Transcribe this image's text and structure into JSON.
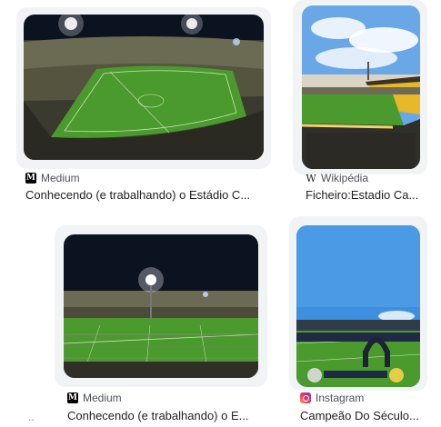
{
  "results": [
    {
      "source": "Medium",
      "favicon": "medium-icon",
      "title": "Conhecendo (e trabalhando) o Estádio C..."
    },
    {
      "source": "Wikipédia",
      "favicon": "wikipedia-icon",
      "title": "Ficheiro:Estadio Ca..."
    },
    {
      "source": "Medium",
      "favicon": "medium-icon",
      "title": "Conhecendo (e trabalhando) o E..."
    },
    {
      "source": "Instagram",
      "favicon": "instagram-icon",
      "title": "Campeão Do Século..."
    }
  ],
  "overflow_marker": "..",
  "colors": {
    "pitch": "#4a9a2e",
    "night_sky": "#0b1220",
    "stand_yellow": "#e8b82a",
    "day_sky": "#3f8fe0"
  }
}
